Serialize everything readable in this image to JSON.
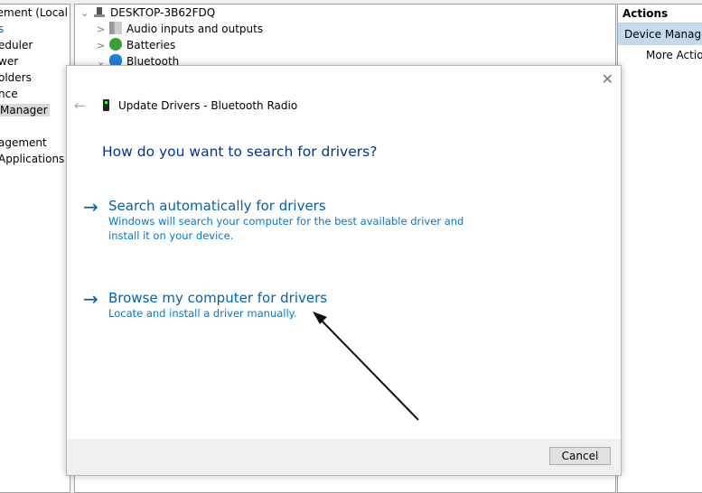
{
  "left_tree": {
    "items": [
      "agement (Local",
      "s",
      "eduler",
      "wer",
      "olders",
      "nce",
      "Manager",
      "",
      "agement",
      "Applications"
    ],
    "selected_index": 6
  },
  "device_tree": {
    "root": "DESKTOP-3B62FDQ",
    "items": [
      "Audio inputs and outputs",
      "Batteries",
      "Bluetooth"
    ]
  },
  "actions": {
    "header": "Actions",
    "section": "Device Manager",
    "more": "More Actions"
  },
  "dialog": {
    "title": "Update Drivers - Bluetooth Radio",
    "heading": "How do you want to search for drivers?",
    "options": [
      {
        "title": "Search automatically for drivers",
        "desc": "Windows will search your computer for the best available driver and install it on your device."
      },
      {
        "title": "Browse my computer for drivers",
        "desc": "Locate and install a driver manually."
      }
    ],
    "cancel": "Cancel"
  },
  "colors": {
    "accent": "#0063b1",
    "selection": "#cce8ff"
  }
}
